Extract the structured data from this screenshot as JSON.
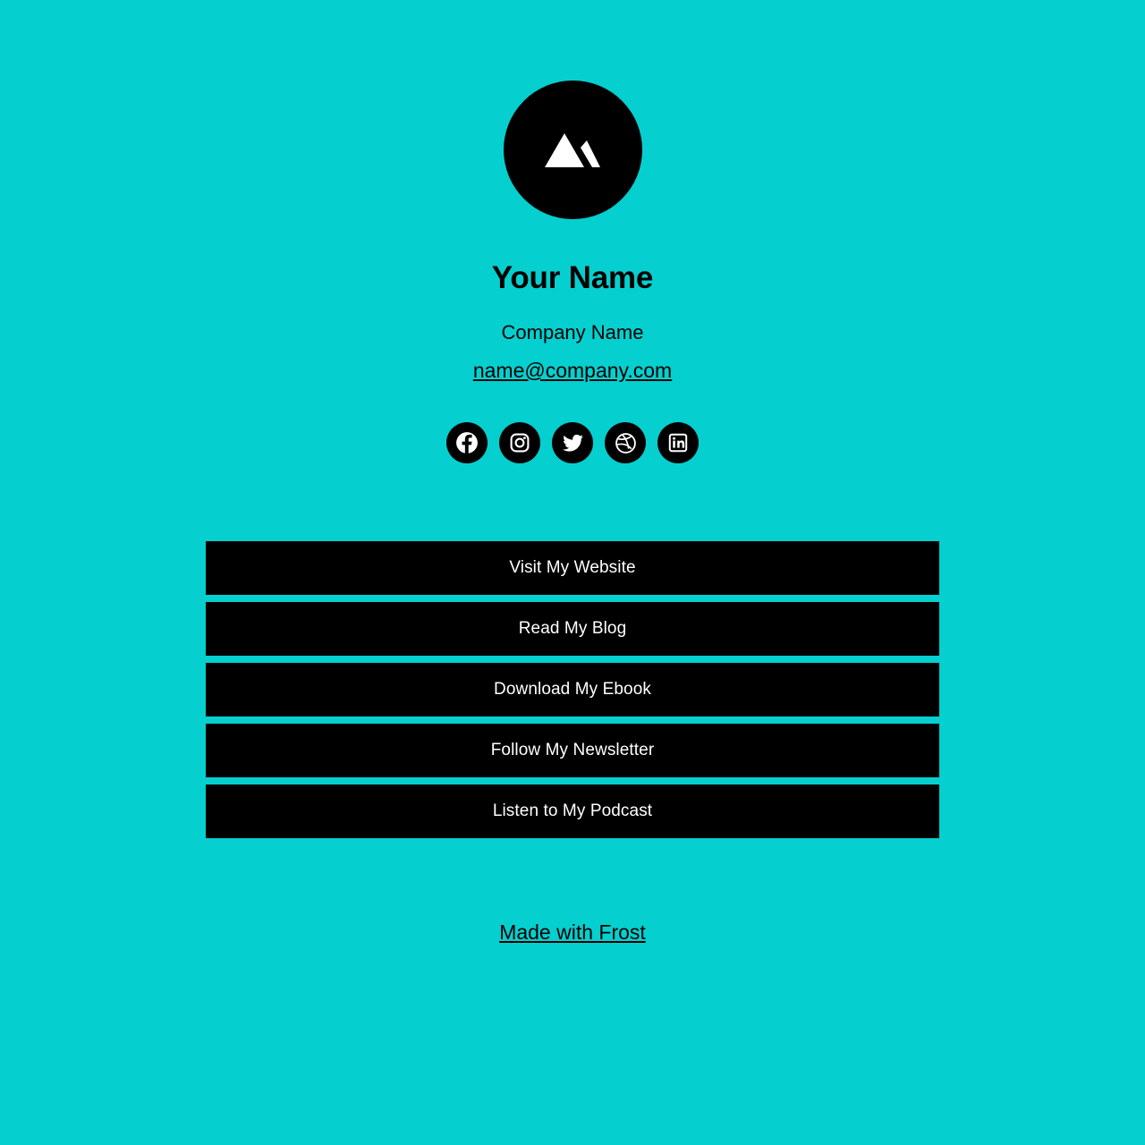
{
  "theme": {
    "background_color": "#05CFCF",
    "accent_color": "#000000",
    "button_text_color": "#FFFFFF"
  },
  "profile": {
    "avatar_icon": "mountain-icon",
    "name": "Your Name",
    "company": "Company Name",
    "email": "name@company.com"
  },
  "socials": [
    {
      "icon": "facebook-icon",
      "label": "Facebook"
    },
    {
      "icon": "instagram-icon",
      "label": "Instagram"
    },
    {
      "icon": "twitter-icon",
      "label": "Twitter"
    },
    {
      "icon": "dribbble-icon",
      "label": "Dribbble"
    },
    {
      "icon": "linkedin-icon",
      "label": "LinkedIn"
    }
  ],
  "links": [
    {
      "label": "Visit My Website"
    },
    {
      "label": "Read My Blog"
    },
    {
      "label": "Download My Ebook"
    },
    {
      "label": "Follow My Newsletter"
    },
    {
      "label": "Listen to My Podcast"
    }
  ],
  "footer": {
    "credit_label": "Made with Frost"
  }
}
